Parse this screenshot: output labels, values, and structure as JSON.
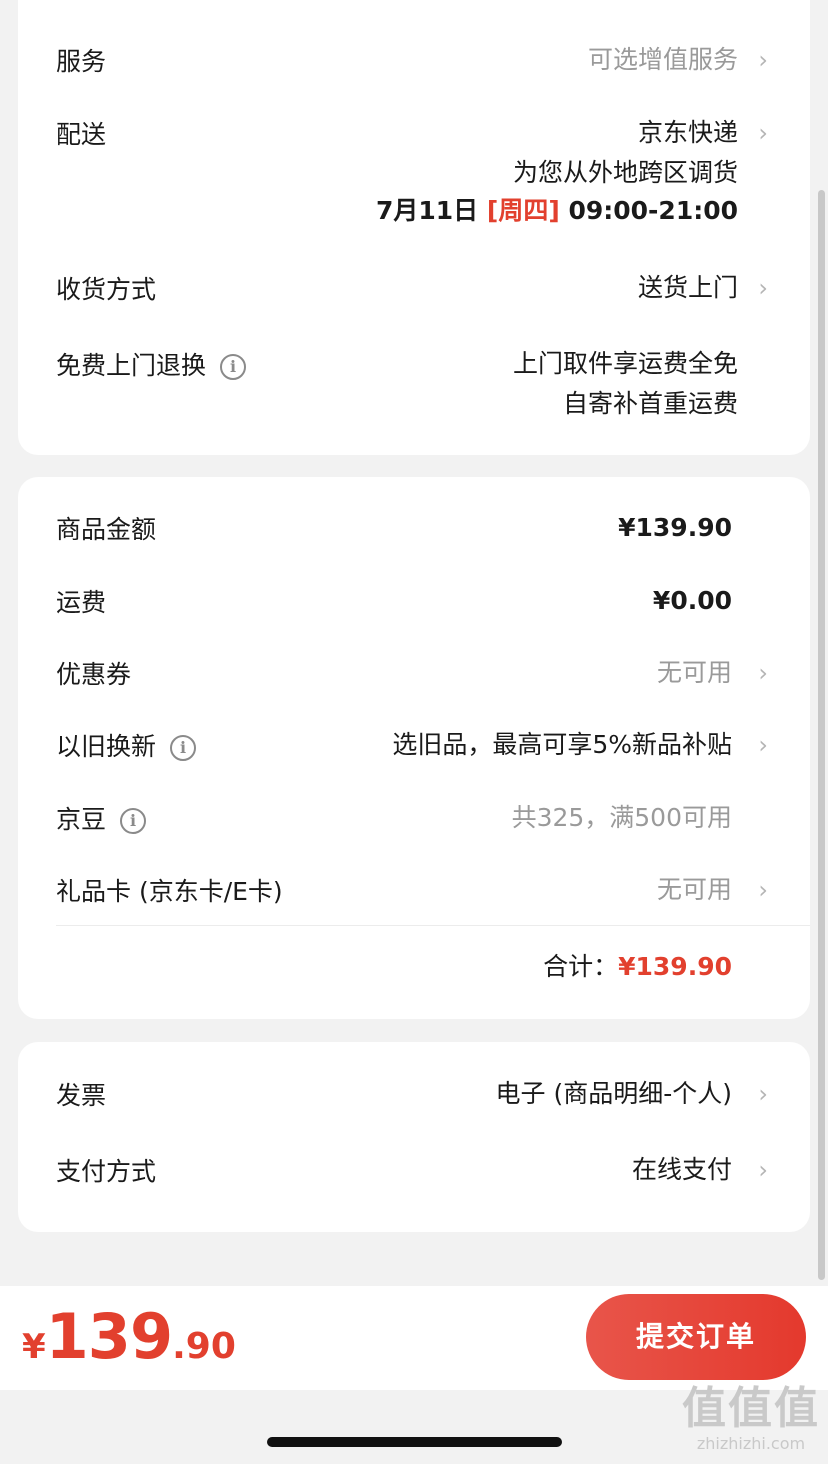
{
  "delivery_card": {
    "service": {
      "label": "服务",
      "value": "可选增值服务"
    },
    "shipping": {
      "label": "配送",
      "carrier": "京东快递",
      "note": "为您从外地跨区调货",
      "date": "7月11日",
      "weekday": "[周四]",
      "time": "09:00-21:00"
    },
    "receive": {
      "label": "收货方式",
      "value": "送货上门"
    },
    "return": {
      "label": "免费上门退换",
      "info_icon": "i",
      "line1": "上门取件享运费全免",
      "line2": "自寄补首重运费"
    }
  },
  "amount_card": {
    "goods": {
      "label": "商品金额",
      "value": "¥139.90"
    },
    "freight": {
      "label": "运费",
      "value": "¥0.00"
    },
    "coupon": {
      "label": "优惠券",
      "value": "无可用"
    },
    "tradein": {
      "label": "以旧换新",
      "info_icon": "i",
      "value": "选旧品，最高可享5%新品补贴"
    },
    "jingdou": {
      "label": "京豆",
      "info_icon": "i",
      "value": "共325，满500可用"
    },
    "giftcard": {
      "label": "礼品卡 (京东卡/E卡)",
      "value": "无可用"
    },
    "total_label": "合计：",
    "total_value": "¥139.90"
  },
  "pay_card": {
    "invoice": {
      "label": "发票",
      "value": "电子 (商品明细-个人)"
    },
    "payment": {
      "label": "支付方式",
      "value": "在线支付"
    }
  },
  "bottom_bar": {
    "currency": "¥",
    "price_int": "139",
    "price_dec": ".90",
    "submit_label": "提交订单"
  },
  "watermark": {
    "logo": "值值值",
    "url": "zhizhizhi.com"
  },
  "colors": {
    "accent": "#e2402e",
    "background": "#f2f2f2",
    "card": "#ffffff"
  },
  "icons": {
    "chevron": "chevron-right-icon",
    "info": "info-circle-icon"
  }
}
